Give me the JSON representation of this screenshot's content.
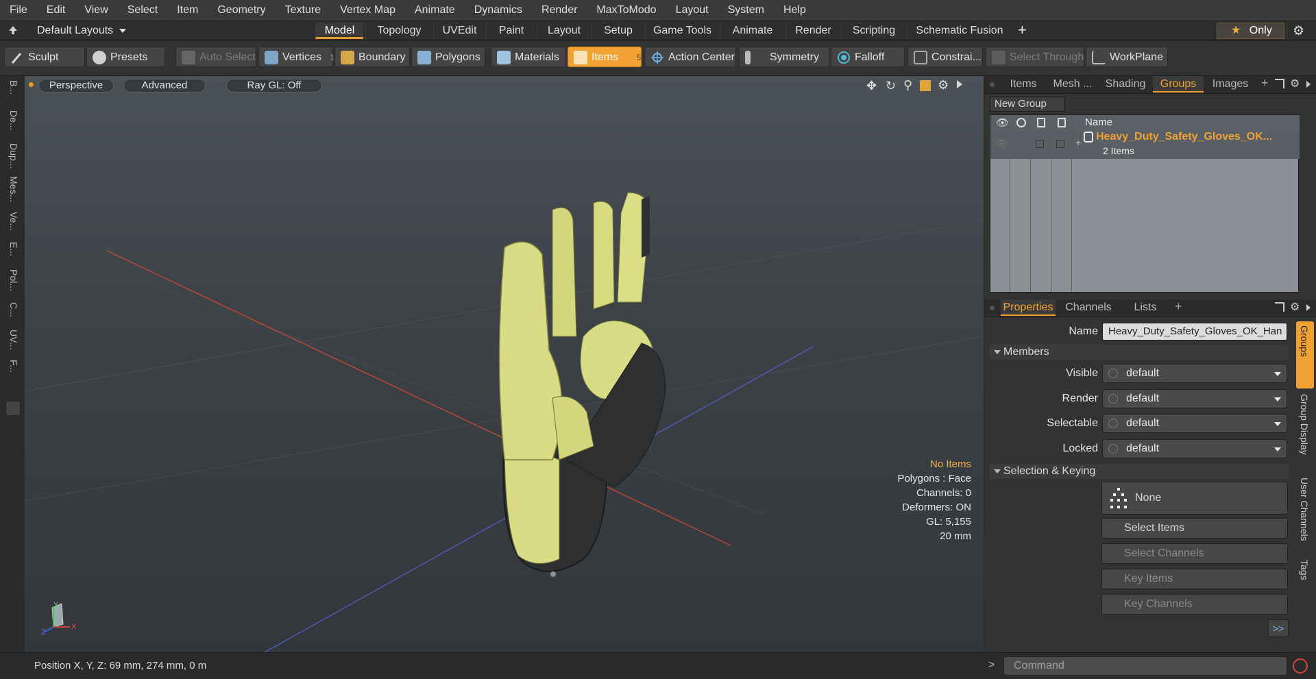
{
  "menu": [
    "File",
    "Edit",
    "View",
    "Select",
    "Item",
    "Geometry",
    "Texture",
    "Vertex Map",
    "Animate",
    "Dynamics",
    "Render",
    "MaxToModo",
    "Layout",
    "System",
    "Help"
  ],
  "layouts": {
    "label": "Default Layouts",
    "tabs": [
      "Model",
      "Topology",
      "UVEdit",
      "Paint",
      "Layout",
      "Setup",
      "Game Tools",
      "Animate",
      "Render",
      "Scripting",
      "Schematic Fusion"
    ],
    "active_tab": "Model",
    "only_label": "Only"
  },
  "toolbar": {
    "sculpt": "Sculpt",
    "presets": "Presets",
    "auto_select": "Auto Select",
    "vertices": "Vertices",
    "vertices_count": "1",
    "boundary": "Boundary",
    "polygons": "Polygons",
    "materials": "Materials",
    "items": "Items",
    "items_count": "5",
    "action_center": "Action Center",
    "symmetry": "Symmetry",
    "falloff": "Falloff",
    "constraints": "Constrai...",
    "select_through": "Select Through",
    "workplane": "WorkPlane"
  },
  "left_tabs": [
    "B...",
    "De...",
    "Dup...",
    "Mes...",
    "Ve...",
    "E...",
    "Pol...",
    "C...",
    "UV...",
    "F..."
  ],
  "viewport": {
    "perspective": "Perspective",
    "advanced": "Advanced",
    "raygl": "Ray GL: Off",
    "info": {
      "no_items": "No Items",
      "polygons": "Polygons : Face",
      "channels": "Channels: 0",
      "deformers": "Deformers: ON",
      "gl": "GL: 5,155",
      "size": "20 mm"
    },
    "axis_y": "Y",
    "axis_x": "X",
    "axis_z": "Z"
  },
  "groups_panel": {
    "tabs": [
      "Items",
      "Mesh ...",
      "Shading",
      "Groups",
      "Images"
    ],
    "active_tab": "Groups",
    "new_group": "New Group",
    "col_name": "Name",
    "group_name": "Heavy_Duty_Safety_Gloves_OK...",
    "group_count": "2 Items"
  },
  "properties_panel": {
    "tabs": [
      "Properties",
      "Channels",
      "Lists"
    ],
    "active_tab": "Properties",
    "name_label": "Name",
    "name_value": "Heavy_Duty_Safety_Gloves_OK_Han",
    "members_section": "Members",
    "fields": [
      {
        "label": "Visible",
        "value": "default"
      },
      {
        "label": "Render",
        "value": "default"
      },
      {
        "label": "Selectable",
        "value": "default"
      },
      {
        "label": "Locked",
        "value": "default"
      }
    ],
    "selection_section": "Selection & Keying",
    "none_label": "None",
    "select_items": "Select Items",
    "select_channels": "Select Channels",
    "key_items": "Key Items",
    "key_channels": "Key Channels",
    "more": ">>",
    "side_tabs": [
      "Groups",
      "Group Display",
      "User Channels",
      "Tags"
    ]
  },
  "status": {
    "position": "Position X, Y, Z:  69 mm, 274 mm, 0 m",
    "command_placeholder": "Command"
  },
  "colors": {
    "accent": "#f0a132",
    "glove_yellow": "#d9dc84",
    "glove_dark": "#2d2f30"
  }
}
